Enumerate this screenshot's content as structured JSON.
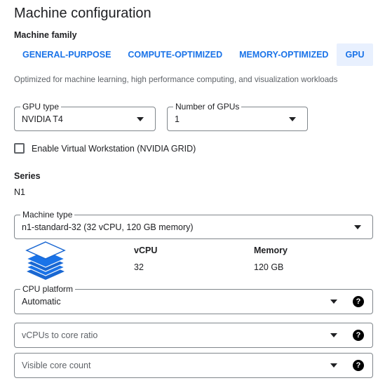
{
  "page": {
    "title": "Machine configuration"
  },
  "machine_family": {
    "label": "Machine family",
    "tabs": [
      {
        "label": "GENERAL-PURPOSE",
        "active": false
      },
      {
        "label": "COMPUTE-OPTIMIZED",
        "active": false
      },
      {
        "label": "MEMORY-OPTIMIZED",
        "active": false
      },
      {
        "label": "GPU",
        "active": true
      }
    ],
    "description": "Optimized for machine learning, high performance computing, and visualization workloads"
  },
  "gpu": {
    "type_label": "GPU type",
    "type_value": "NVIDIA T4",
    "count_label": "Number of GPUs",
    "count_value": "1",
    "virtual_workstation_label": "Enable Virtual Workstation (NVIDIA GRID)",
    "virtual_workstation_checked": false
  },
  "series": {
    "label": "Series",
    "value": "N1"
  },
  "machine_type": {
    "label": "Machine type",
    "value": "n1-standard-32 (32 vCPU, 120 GB memory)",
    "vcpu_header": "vCPU",
    "vcpu_value": "32",
    "memory_header": "Memory",
    "memory_value": "120 GB",
    "icon": "stacked-layers-icon"
  },
  "cpu_platform": {
    "label": "CPU platform",
    "value": "Automatic"
  },
  "vcpus_ratio": {
    "placeholder": "vCPUs to core ratio"
  },
  "visible_cores": {
    "placeholder": "Visible core count"
  },
  "help_glyph": "?",
  "colors": {
    "accent": "#1a73e8",
    "tab_active_bg": "#e8f0fe",
    "icon_blue": "#1967d2",
    "border": "#80868b"
  }
}
